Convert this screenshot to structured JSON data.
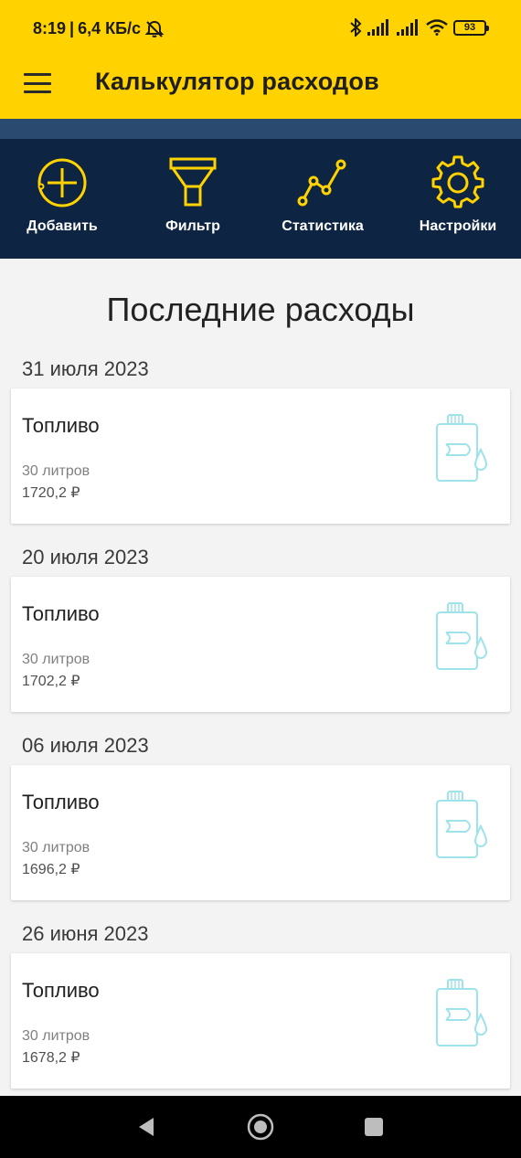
{
  "status_bar": {
    "time": "8:19",
    "separator": "|",
    "net_speed": "6,4 КБ/с",
    "battery": "93",
    "icons": [
      "mute-icon",
      "bluetooth-icon",
      "signal-icon",
      "signal-icon",
      "wifi-icon",
      "battery-icon"
    ]
  },
  "app_bar": {
    "title": "Калькулятор расходов",
    "menu_icon": "hamburger-menu-icon"
  },
  "toolbar": {
    "items": [
      {
        "label": "Добавить",
        "icon": "add-circle-icon"
      },
      {
        "label": "Фильтр",
        "icon": "funnel-icon"
      },
      {
        "label": "Статистика",
        "icon": "line-chart-icon"
      },
      {
        "label": "Настройки",
        "icon": "gear-icon"
      }
    ]
  },
  "section_title": "Последние расходы",
  "entries": [
    {
      "date": "31 июля 2023",
      "category": "Топливо",
      "quantity": "30 литров",
      "amount": "1720,2 ₽",
      "icon": "fuel-canister-icon"
    },
    {
      "date": "20 июля 2023",
      "category": "Топливо",
      "quantity": "30 литров",
      "amount": "1702,2 ₽",
      "icon": "fuel-canister-icon"
    },
    {
      "date": "06 июля 2023",
      "category": "Топливо",
      "quantity": "30 литров",
      "amount": "1696,2 ₽",
      "icon": "fuel-canister-icon"
    },
    {
      "date": "26 июня 2023",
      "category": "Топливо",
      "quantity": "30 литров",
      "amount": "1678,2 ₽",
      "icon": "fuel-canister-icon"
    }
  ],
  "nav_bar": {
    "buttons": [
      "back-icon",
      "home-icon",
      "recents-icon"
    ]
  },
  "colors": {
    "app_bar": "#ffd200",
    "toolbar": "#0d2543",
    "stripe": "#2b4a70",
    "toolbar_icon": "#ffd200",
    "fuel_icon": "#9ee3ea",
    "background": "#f3f3f3"
  }
}
